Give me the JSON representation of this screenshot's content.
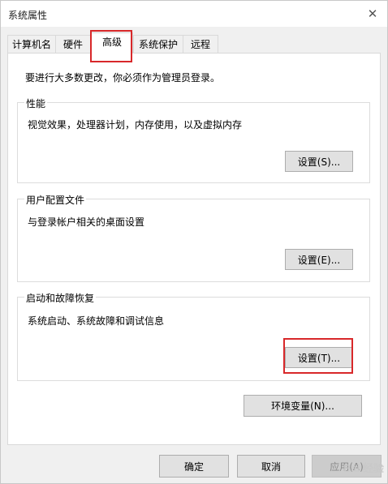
{
  "window": {
    "title": "系统属性",
    "close_glyph": "✕"
  },
  "tabs": [
    {
      "label": "计算机名",
      "active": false
    },
    {
      "label": "硬件",
      "active": false
    },
    {
      "label": "高级",
      "active": true
    },
    {
      "label": "系统保护",
      "active": false
    },
    {
      "label": "远程",
      "active": false
    }
  ],
  "main": {
    "intro": "要进行大多数更改，你必须作为管理员登录。",
    "groups": [
      {
        "title": "性能",
        "description": "视觉效果，处理器计划，内存使用，以及虚拟内存",
        "button": "设置(S)..."
      },
      {
        "title": "用户配置文件",
        "description": "与登录帐户相关的桌面设置",
        "button": "设置(E)..."
      },
      {
        "title": "启动和故障恢复",
        "description": "系统启动、系统故障和调试信息",
        "button": "设置(T)..."
      }
    ],
    "env_button": "环境变量(N)..."
  },
  "footer": {
    "ok": "确定",
    "cancel": "取消",
    "apply": "应用(A)"
  },
  "highlight_color": "#d8282a",
  "watermark": "Bai 经验"
}
